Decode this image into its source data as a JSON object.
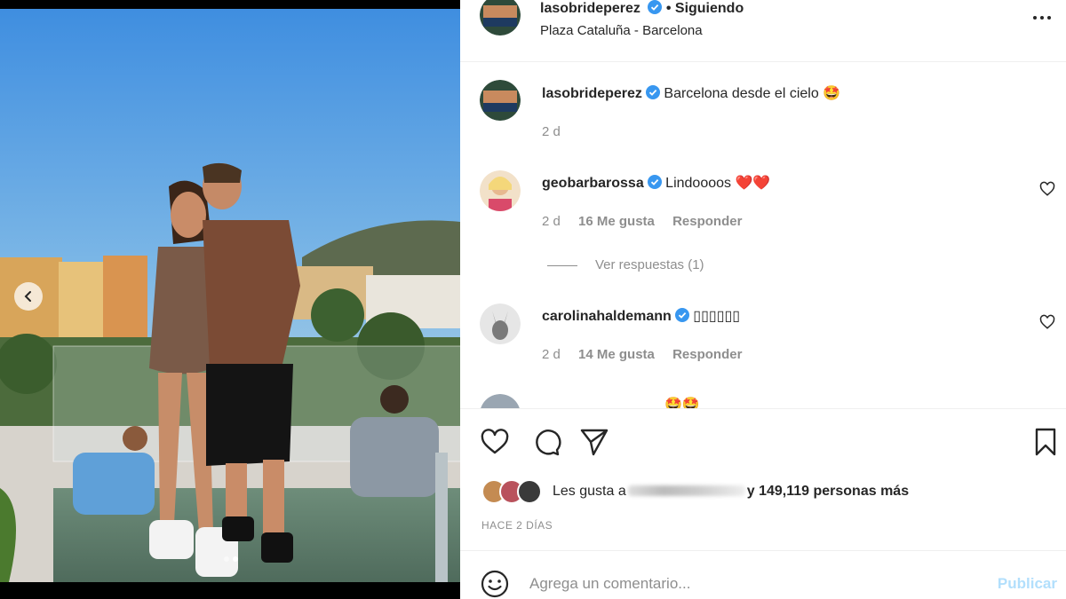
{
  "post": {
    "author": "lasobrideperez",
    "following_label": "• Siguiendo",
    "location": "Plaza Cataluña - Barcelona",
    "more_icon": "more-horizontal-icon"
  },
  "caption": {
    "author": "lasobrideperez",
    "text": "Barcelona desde el cielo 🤩",
    "time": "2 d"
  },
  "comments": [
    {
      "author": "geobarbarossa",
      "text": "Lindoooos ❤️❤️",
      "time": "2 d",
      "likes": "16 Me gusta",
      "reply": "Responder",
      "view_replies": "Ver respuestas (1)"
    },
    {
      "author": "carolinahaldemann",
      "text": "▯▯▯▯▯▯",
      "time": "2 d",
      "likes": "14 Me gusta",
      "reply": "Responder"
    },
    {
      "author": "",
      "text": "🤩🤩"
    }
  ],
  "likes_summary": {
    "prefix": "Les gusta a",
    "suffix": "y 149,119 personas más"
  },
  "timestamp": "HACE 2 DÍAS",
  "add_comment": {
    "placeholder": "Agrega un comentario...",
    "publish_label": "Publicar"
  },
  "colors": {
    "verified": "#3897f0",
    "publish": "#b2dffc",
    "heart": "#ed4956"
  }
}
